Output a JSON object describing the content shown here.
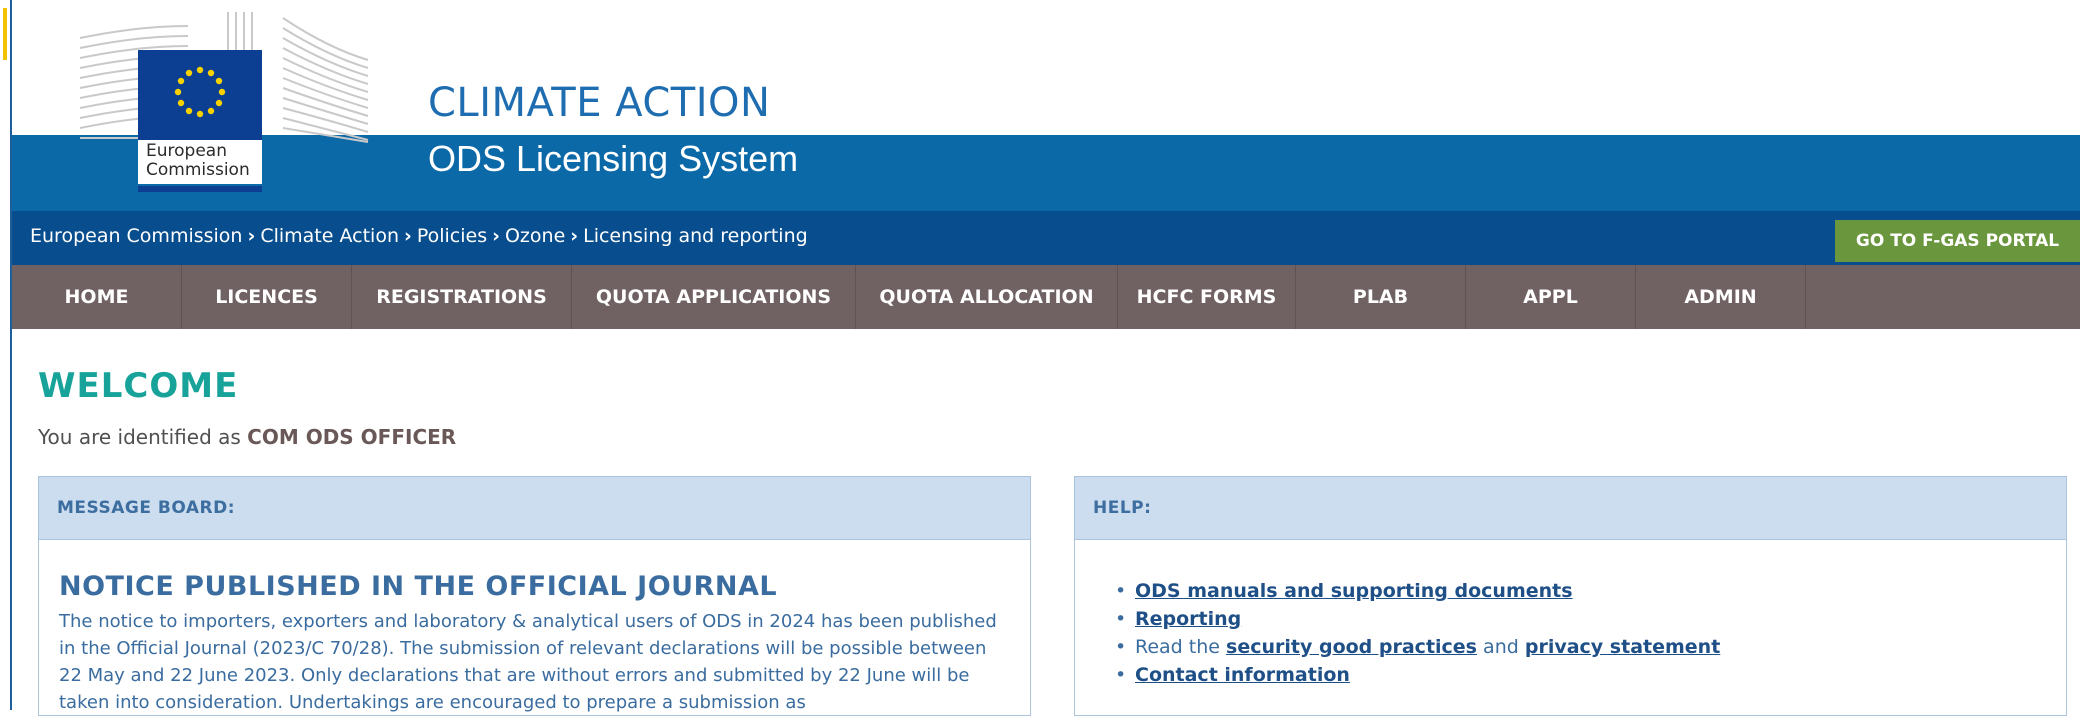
{
  "header": {
    "logo_caption_line1": "European",
    "logo_caption_line2": "Commission",
    "title": "CLIMATE ACTION",
    "subtitle": "ODS Licensing System"
  },
  "breadcrumb": [
    "European Commission",
    "Climate Action",
    "Policies",
    "Ozone",
    "Licensing and reporting"
  ],
  "fgas_button": "GO TO F-GAS PORTAL",
  "nav": [
    "HOME",
    "LICENCES",
    "REGISTRATIONS",
    "QUOTA APPLICATIONS",
    "QUOTA ALLOCATION",
    "HCFC FORMS",
    "PLAB",
    "APPL",
    "ADMIN"
  ],
  "welcome": {
    "heading": "WELCOME",
    "identified_prefix": "You are identified as",
    "user_role": "COM ODS OFFICER"
  },
  "message_board": {
    "heading": "MESSAGE BOARD:",
    "notice_title": "NOTICE PUBLISHED IN THE OFFICIAL JOURNAL",
    "notice_body": "The notice to importers, exporters and laboratory & analytical users of ODS in 2024 has been published in the Official Journal (2023/C 70/28). The submission of relevant declarations will be possible between 22 May and 22 June 2023. Only declarations that are without errors and submitted by 22 June will be taken into consideration. Undertakings are encouraged to prepare a submission as"
  },
  "help": {
    "heading": "HELP:",
    "link_manuals": "ODS manuals and supporting documents",
    "link_reporting": "Reporting",
    "read_the": "Read the",
    "link_security": "security good practices",
    "and_word": "and",
    "link_privacy": "privacy statement",
    "link_contact": "Contact information"
  },
  "colors": {
    "blue_band": "#0b69a8",
    "breadcrumb_bar": "#084d8d",
    "nav_bar": "#706263",
    "fgas_button": "#6a963d",
    "welcome_heading": "#17a39a",
    "panel_header": "#cbddef"
  }
}
